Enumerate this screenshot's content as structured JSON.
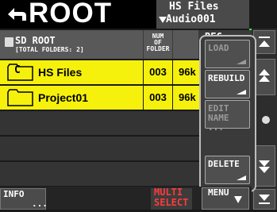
{
  "header": {
    "title": "ROOT",
    "current_line1": "HS Files",
    "current_line2": "Audio001"
  },
  "columns": {
    "name_line1": "SD ROOT",
    "name_line2": "[TOTAL FOLDERS: 2]",
    "num_line1": "NUM",
    "num_line2": "OF",
    "num_line3": "FOLDER",
    "rec_line1": "REC",
    "rec_line2": "Fs"
  },
  "rows": [
    {
      "badge": "C",
      "name": "HS Files",
      "num": "003",
      "fs": "96k"
    },
    {
      "badge": "",
      "name": "Project01",
      "num": "003",
      "fs": "96k"
    }
  ],
  "popup": {
    "load": "LOAD",
    "rebuild": "REBUILD",
    "edit_line1": "EDIT",
    "edit_line2": "NAME ...",
    "delete": "DELETE"
  },
  "bottom": {
    "info": "INFO",
    "info_dots": "...",
    "multi_line1": "MULTI",
    "multi_line2": "SELECT",
    "menu": "MENU"
  },
  "colors": {
    "selected_row": "#f6f10c",
    "accent_green": "#3aef3a",
    "multi_select_text": "#ff3b3b"
  }
}
